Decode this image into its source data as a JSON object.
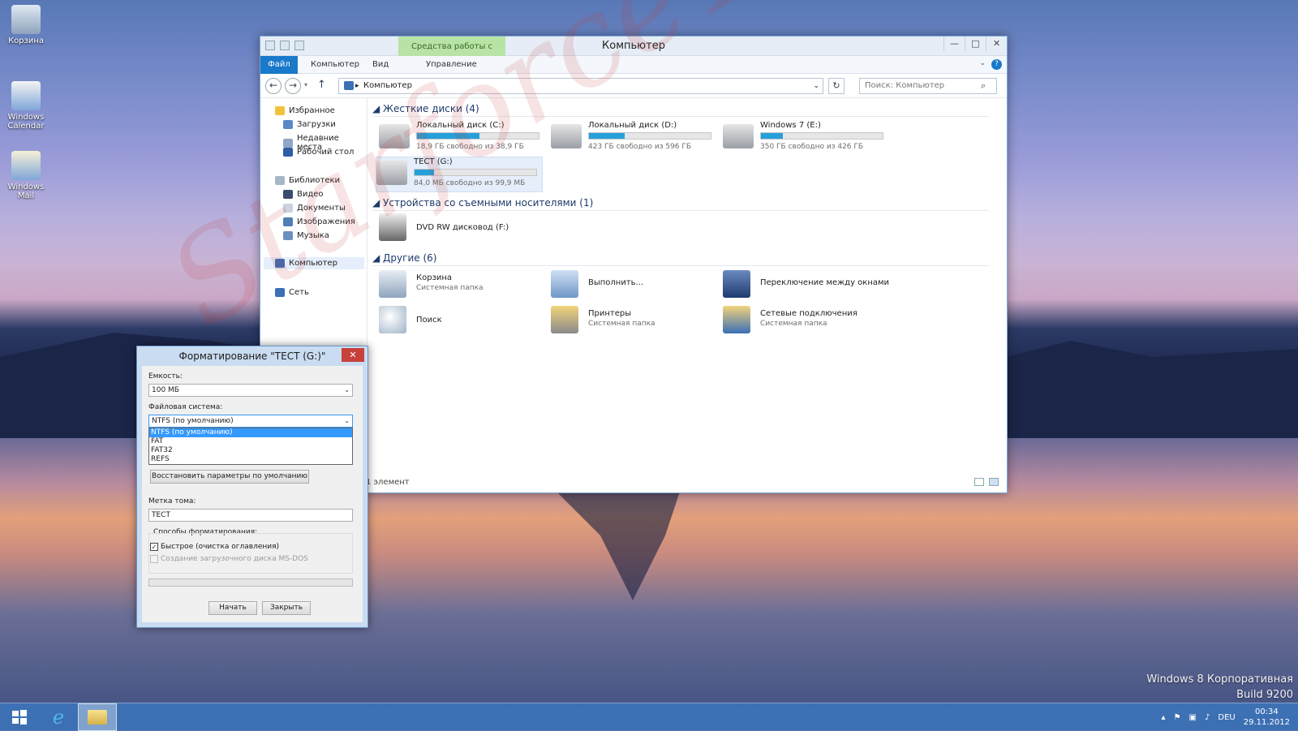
{
  "desktop": {
    "icons": [
      {
        "label": "Корзина",
        "icon": "recycle-bin-icon"
      },
      {
        "label": "Windows Calendar",
        "icon": "calendar-icon"
      },
      {
        "label": "Windows Mail",
        "icon": "mail-icon"
      }
    ],
    "os_edition": "Windows 8 Корпоративная",
    "os_build": "Build 9200",
    "watermark": "StarforceTEAM"
  },
  "taskbar": {
    "apps": [
      "start-icon",
      "internet-explorer-icon",
      "file-explorer-icon"
    ],
    "language": "DEU",
    "time": "00:34",
    "date": "29.11.2012"
  },
  "explorer": {
    "title": "Компьютер",
    "context_tab": "Средства работы с дисками",
    "ribbon_tabs": [
      "Файл",
      "Компьютер",
      "Вид",
      "Управление"
    ],
    "address": "Компьютер",
    "search_placeholder": "Поиск: Компьютер",
    "nav": {
      "favorites": "Избранное",
      "downloads": "Загрузки",
      "recent": "Недавние места",
      "desktop": "Рабочий стол",
      "libraries": "Библиотеки",
      "video": "Видео",
      "documents": "Документы",
      "pictures": "Изображения",
      "music": "Музыка",
      "computer": "Компьютер",
      "network": "Сеть"
    },
    "groups": {
      "hard_disks": "Жесткие диски (4)",
      "removable": "Устройства со съемными носителями (1)",
      "other": "Другие (6)"
    },
    "drives": [
      {
        "name": "Локальный диск (C:)",
        "free": "18,9 ГБ свободно из 38,9 ГБ",
        "used_fraction": 0.51
      },
      {
        "name": "Локальный диск (D:)",
        "free": "423 ГБ свободно из 596 ГБ",
        "used_fraction": 0.29
      },
      {
        "name": "Windows 7 (E:)",
        "free": "350 ГБ свободно из 426 ГБ",
        "used_fraction": 0.18
      },
      {
        "name": "ТЕСТ (G:)",
        "free": "84,0 МБ свободно из 99,9 МБ",
        "used_fraction": 0.16
      }
    ],
    "removable": [
      {
        "name": "DVD RW дисковод (F:)"
      }
    ],
    "others": [
      {
        "name": "Корзина",
        "sub": "Системная папка"
      },
      {
        "name": "Выполнить...",
        "sub": ""
      },
      {
        "name": "Переключение между окнами",
        "sub": ""
      },
      {
        "name": "Поиск",
        "sub": ""
      },
      {
        "name": "Принтеры",
        "sub": "Системная папка"
      },
      {
        "name": "Сетевые подключения",
        "sub": "Системная папка"
      }
    ],
    "status": "1 элемент"
  },
  "format_dialog": {
    "title": "Форматирование \"ТЕСТ (G:)\"",
    "capacity_label": "Емкость:",
    "capacity_value": "100 МБ",
    "fs_label": "Файловая система:",
    "fs_value": "NTFS (по умолчанию)",
    "fs_options": [
      "NTFS (по умолчанию)",
      "FAT",
      "FAT32",
      "REFS"
    ],
    "restore_button": "Восстановить параметры по умолчанию",
    "volume_label": "Метка тома:",
    "volume_value": "ТЕСТ",
    "format_options_label": "Способы форматирования:",
    "quick_format": "Быстрое (очистка оглавления)",
    "msdos_disk": "Создание загрузочного диска MS-DOS",
    "start_button": "Начать",
    "close_button": "Закрыть"
  }
}
